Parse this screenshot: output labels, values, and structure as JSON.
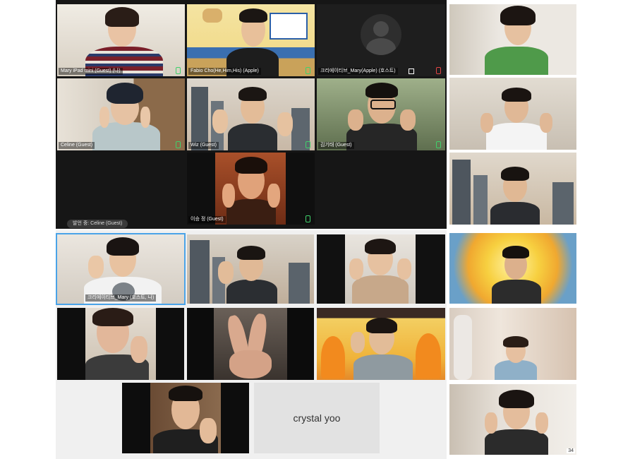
{
  "top_grid": {
    "tiles": [
      {
        "label": "Mary iPad mini (Guest) (나)"
      },
      {
        "label": "Fabio Cho(He,Him,His) (Apple)"
      },
      {
        "label": "크리에이티브_Mary(Apple) (호스트)"
      },
      {
        "label": "Celine (Guest)"
      },
      {
        "label": "Wiz (Guest)"
      },
      {
        "label": "김기태 (Guest)"
      },
      {
        "label": "이승 정 (Guest)"
      }
    ],
    "speaking_label": "발언 중: Celine (Guest)"
  },
  "bottom_grid": {
    "host_label": "크리에이티브_Mary (호스트, 나)",
    "camera_off_name": "crystal yoo"
  },
  "right_column": {
    "corner_badge": "34"
  },
  "colors": {
    "panel_bg": "#1a1a1a",
    "active_speaker": "#4aa3e8",
    "mic_green": "#3fd16b"
  }
}
